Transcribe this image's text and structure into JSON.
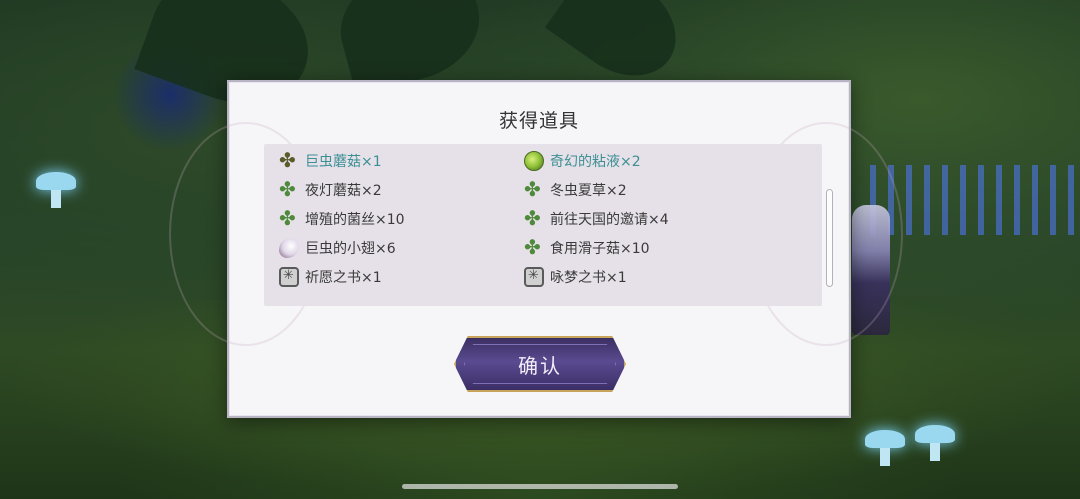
{
  "dialog": {
    "title": "获得道具",
    "items": [
      {
        "label": "巨虫蘑菇×1",
        "icon": "dark-clover-icon",
        "highlight": true
      },
      {
        "label": "奇幻的粘液×2",
        "icon": "slime-icon",
        "highlight": true
      },
      {
        "label": "夜灯蘑菇×2",
        "icon": "clover-icon",
        "highlight": false
      },
      {
        "label": "冬虫夏草×2",
        "icon": "clover-icon",
        "highlight": false
      },
      {
        "label": "增殖的菌丝×10",
        "icon": "clover-icon",
        "highlight": false
      },
      {
        "label": "前往天国的邀请×4",
        "icon": "clover-icon",
        "highlight": false
      },
      {
        "label": "巨虫的小翅×6",
        "icon": "wing-icon",
        "highlight": false
      },
      {
        "label": "食用滑子菇×10",
        "icon": "clover-icon",
        "highlight": false
      },
      {
        "label": "祈愿之书×1",
        "icon": "book-icon",
        "highlight": false
      },
      {
        "label": "咏梦之书×1",
        "icon": "book-icon",
        "highlight": false
      }
    ],
    "confirm_label": "确认",
    "highlight_color": "#3c8f94"
  }
}
